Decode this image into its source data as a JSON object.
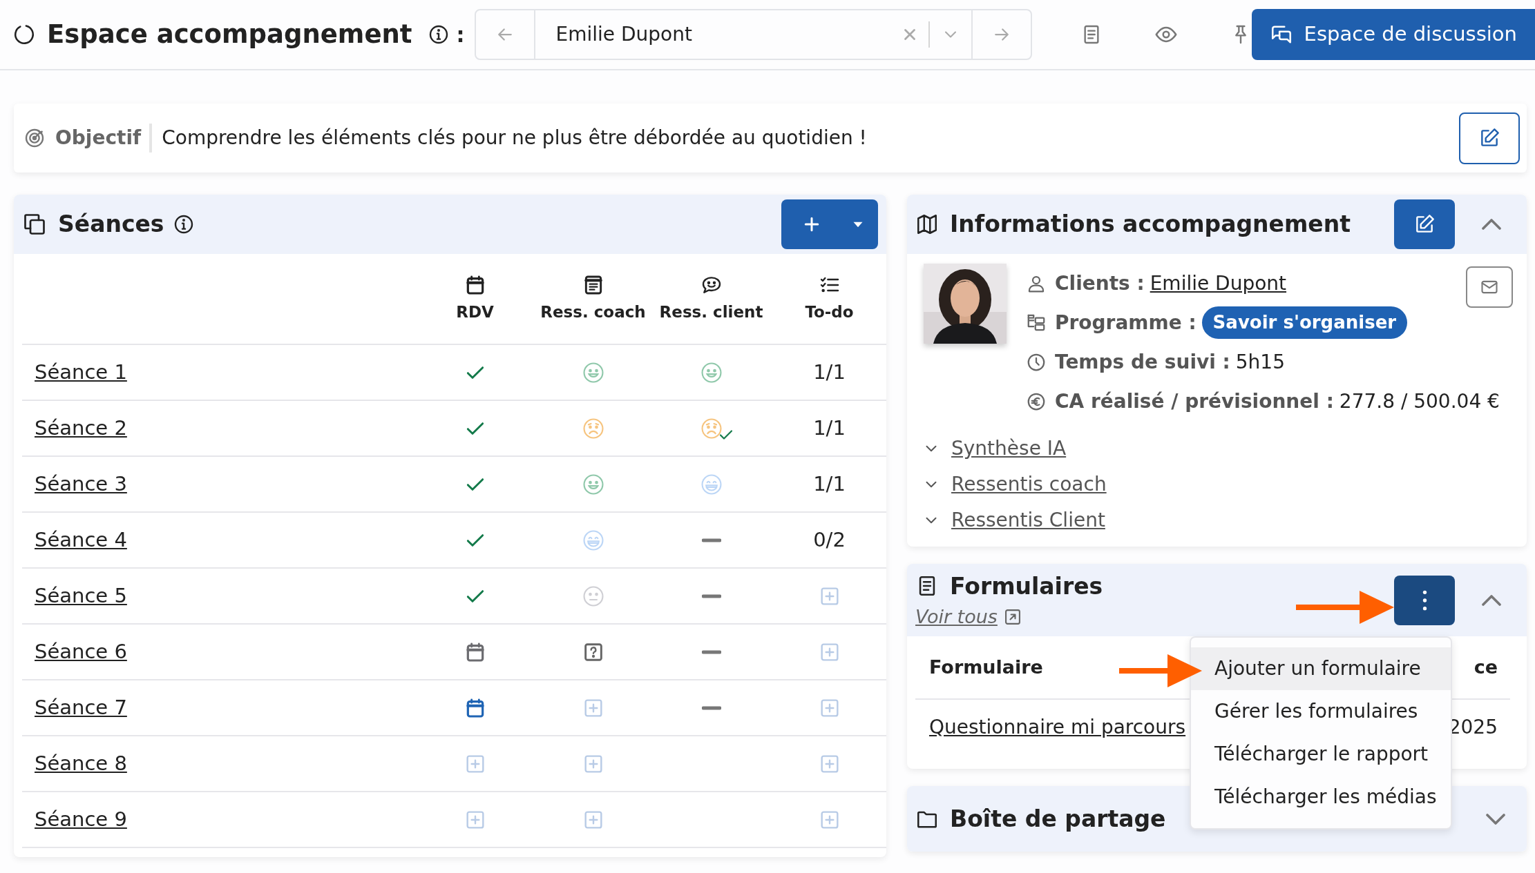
{
  "header": {
    "title": "Espace accompagnement",
    "separator": ":",
    "client_select": {
      "value": "Emilie Dupont"
    },
    "discussion_button": "Espace de discussion"
  },
  "objective": {
    "label": "Objectif",
    "text": "Comprendre les éléments clés pour ne plus être débordée au quotidien !"
  },
  "sessions": {
    "title": "Séances",
    "columns": [
      "RDV",
      "Ress. coach",
      "Ress. client",
      "To-do"
    ],
    "rows": [
      {
        "name": "Séance 1",
        "cells": [
          {
            "kind": "check"
          },
          {
            "kind": "smile",
            "color": "#8fc8aa"
          },
          {
            "kind": "smile",
            "color": "#8fc8aa"
          },
          {
            "kind": "text",
            "text": "1/1"
          }
        ]
      },
      {
        "name": "Séance 2",
        "cells": [
          {
            "kind": "check"
          },
          {
            "kind": "sad",
            "color": "#f6c47f"
          },
          {
            "kind": "sad",
            "color": "#f6c47f",
            "validated": true
          },
          {
            "kind": "text",
            "text": "1/1"
          }
        ]
      },
      {
        "name": "Séance 3",
        "cells": [
          {
            "kind": "check"
          },
          {
            "kind": "smile",
            "color": "#8fc8aa"
          },
          {
            "kind": "grin",
            "color": "#bcd6f6"
          },
          {
            "kind": "text",
            "text": "1/1"
          }
        ]
      },
      {
        "name": "Séance 4",
        "cells": [
          {
            "kind": "check"
          },
          {
            "kind": "grin",
            "color": "#bcd6f6"
          },
          {
            "kind": "dash"
          },
          {
            "kind": "text",
            "text": "0/2"
          }
        ]
      },
      {
        "name": "Séance 5",
        "cells": [
          {
            "kind": "check"
          },
          {
            "kind": "neutral",
            "color": "#cfcfd4"
          },
          {
            "kind": "dash"
          },
          {
            "kind": "add"
          }
        ]
      },
      {
        "name": "Séance 6",
        "cells": [
          {
            "kind": "calendar",
            "color": "#6c6c70"
          },
          {
            "kind": "question"
          },
          {
            "kind": "dash"
          },
          {
            "kind": "add"
          }
        ]
      },
      {
        "name": "Séance 7",
        "cells": [
          {
            "kind": "calendar",
            "color": "#1f64b4"
          },
          {
            "kind": "add"
          },
          {
            "kind": "dash"
          },
          {
            "kind": "add"
          }
        ]
      },
      {
        "name": "Séance 8",
        "cells": [
          {
            "kind": "add"
          },
          {
            "kind": "add"
          },
          {
            "kind": "empty"
          },
          {
            "kind": "add"
          }
        ]
      },
      {
        "name": "Séance 9",
        "cells": [
          {
            "kind": "add"
          },
          {
            "kind": "add"
          },
          {
            "kind": "empty"
          },
          {
            "kind": "add"
          }
        ]
      }
    ]
  },
  "info": {
    "title": "Informations accompagnement",
    "expanded": true,
    "fields": [
      {
        "kind": "link",
        "label": "Clients :",
        "value": "Emilie Dupont"
      },
      {
        "kind": "badge",
        "label": "Programme :",
        "value": "Savoir s'organiser"
      },
      {
        "kind": "text",
        "label": "Temps de suivi :",
        "value": "5h15"
      },
      {
        "kind": "text",
        "label": "CA réalisé / prévisionnel :",
        "value": "277.8 / 500.04 €"
      }
    ],
    "sections": [
      {
        "label": "Synthèse IA",
        "expanded": false
      },
      {
        "label": "Ressentis coach",
        "expanded": false
      },
      {
        "label": "Ressentis Client",
        "expanded": false
      }
    ]
  },
  "forms": {
    "title": "Formulaires",
    "link": "Voir tous",
    "expanded": true,
    "columns": [
      "Formulaire",
      "ce"
    ],
    "rows": [
      [
        "Questionnaire mi parcours",
        "2025"
      ]
    ],
    "menu": {
      "items": [
        {
          "label": "Ajouter un formulaire",
          "selected": true
        },
        {
          "label": "Gérer les formulaires",
          "selected": false
        },
        {
          "label": "Télécharger le rapport",
          "selected": false
        },
        {
          "label": "Télécharger les médias",
          "selected": false
        }
      ]
    }
  },
  "share": {
    "title": "Boîte de partage",
    "expanded": false
  }
}
